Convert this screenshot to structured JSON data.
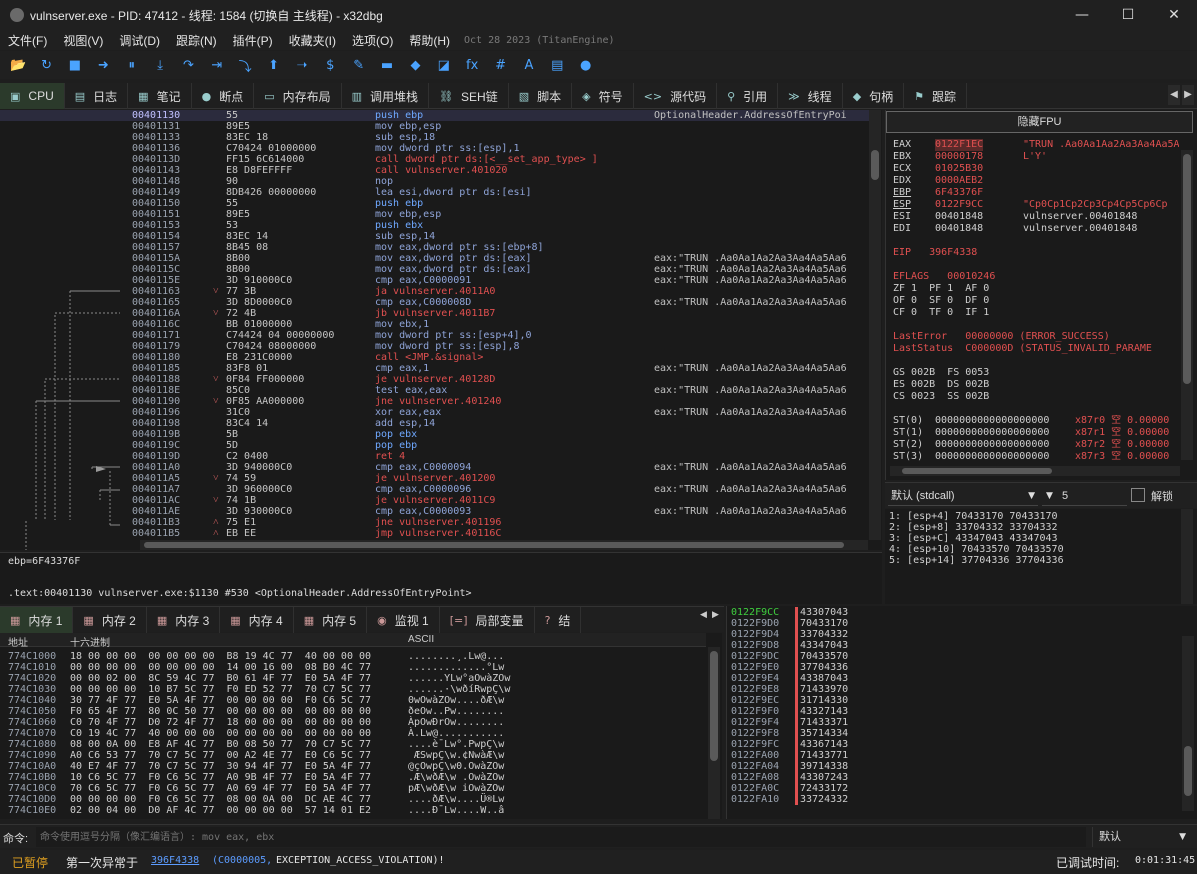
{
  "window": {
    "title": "vulnserver.exe - PID: 47412 - 线程: 1584 (切换自 主线程) - x32dbg",
    "minimize": "—",
    "maximize": "☐",
    "close": "✕"
  },
  "menu": {
    "items": [
      "文件(F)",
      "视图(V)",
      "调试(D)",
      "跟踪(N)",
      "插件(P)",
      "收藏夹(I)",
      "选项(O)",
      "帮助(H)"
    ],
    "version": "Oct 28 2023 (TitanEngine)"
  },
  "toolbar": {
    "icons": [
      "open-icon",
      "restart-icon",
      "stop-icon",
      "run-icon",
      "pause-icon",
      "step-into-icon",
      "step-over-icon",
      "trace-into-icon",
      "trace-over-icon",
      "execute-till-return-icon",
      "run-to-user-code-icon",
      "scylla-icon",
      "patch-icon",
      "comment-icon",
      "label-icon",
      "bookmark-icon",
      "function-icon",
      "hash-icon",
      "strings-icon",
      "calculator-icon",
      "globe-icon"
    ],
    "glyphs": [
      "📂",
      "↻",
      "■",
      "➜",
      "⏸",
      "⤓",
      "↷",
      "⇥",
      "⤵",
      "⬆",
      "➝",
      "$",
      "✎",
      "▬",
      "◆",
      "◪",
      "fx",
      "#",
      "A",
      "▤",
      "●"
    ]
  },
  "tabs": [
    {
      "label": "CPU",
      "icon": "▣"
    },
    {
      "label": "日志",
      "icon": "▤"
    },
    {
      "label": "笔记",
      "icon": "▦"
    },
    {
      "label": "断点",
      "icon": "●"
    },
    {
      "label": "内存布局",
      "icon": "▭"
    },
    {
      "label": "调用堆栈",
      "icon": "▥"
    },
    {
      "label": "SEH链",
      "icon": "⛓"
    },
    {
      "label": "脚本",
      "icon": "▧"
    },
    {
      "label": "符号",
      "icon": "◈"
    },
    {
      "label": "源代码",
      "icon": "<>"
    },
    {
      "label": "引用",
      "icon": "⚲"
    },
    {
      "label": "线程",
      "icon": "≫"
    },
    {
      "label": "句柄",
      "icon": "◆"
    },
    {
      "label": "跟踪",
      "icon": "⚑"
    }
  ],
  "disasm": {
    "rows": [
      {
        "addr": "00401130",
        "bytes": "55",
        "ins": "push ebp",
        "cmt": "OptionalHeader.AddressOfEntryPoi"
      },
      {
        "addr": "00401131",
        "bytes": "89E5",
        "ins": "mov ebp,esp",
        "cmt": ""
      },
      {
        "addr": "00401133",
        "bytes": "83EC 18",
        "ins": "sub esp,18",
        "cmt": ""
      },
      {
        "addr": "00401136",
        "bytes": "C70424 01000000",
        "ins": "mov dword ptr ss:[esp],1",
        "cmt": ""
      },
      {
        "addr": "0040113D",
        "bytes": "FF15 6C614000",
        "ins": "call dword ptr ds:[<__set_app_type> ]",
        "cmt": ""
      },
      {
        "addr": "00401143",
        "bytes": "E8 D8FEFFFF",
        "ins": "call vulnserver.401020",
        "cmt": ""
      },
      {
        "addr": "00401148",
        "bytes": "90",
        "ins": "nop",
        "cmt": ""
      },
      {
        "addr": "00401149",
        "bytes": "8DB426 00000000",
        "ins": "lea esi,dword ptr ds:[esi]",
        "cmt": ""
      },
      {
        "addr": "00401150",
        "bytes": "55",
        "ins": "push ebp",
        "cmt": ""
      },
      {
        "addr": "00401151",
        "bytes": "89E5",
        "ins": "mov ebp,esp",
        "cmt": ""
      },
      {
        "addr": "00401153",
        "bytes": "53",
        "ins": "push ebx",
        "cmt": ""
      },
      {
        "addr": "00401154",
        "bytes": "83EC 14",
        "ins": "sub esp,14",
        "cmt": ""
      },
      {
        "addr": "00401157",
        "bytes": "8B45 08",
        "ins": "mov eax,dword ptr ss:[ebp+8]",
        "cmt": ""
      },
      {
        "addr": "0040115A",
        "bytes": "8B00",
        "ins": "mov eax,dword ptr ds:[eax]",
        "cmt": "eax:\"TRUN .Aa0Aa1Aa2Aa3Aa4Aa5Aa6"
      },
      {
        "addr": "0040115C",
        "bytes": "8B00",
        "ins": "mov eax,dword ptr ds:[eax]",
        "cmt": "eax:\"TRUN .Aa0Aa1Aa2Aa3Aa4Aa5Aa6"
      },
      {
        "addr": "0040115E",
        "bytes": "3D 910000C0",
        "ins": "cmp eax,C0000091",
        "cmt": "eax:\"TRUN .Aa0Aa1Aa2Aa3Aa4Aa5Aa6"
      },
      {
        "addr": "00401163",
        "bytes": "77 3B",
        "ins": "ja vulnserver.4011A0",
        "cmt": "",
        "jm": "˅"
      },
      {
        "addr": "00401165",
        "bytes": "3D 8D0000C0",
        "ins": "cmp eax,C000008D",
        "cmt": "eax:\"TRUN .Aa0Aa1Aa2Aa3Aa4Aa5Aa6"
      },
      {
        "addr": "0040116A",
        "bytes": "72 4B",
        "ins": "jb vulnserver.4011B7",
        "cmt": "",
        "jm": "˅"
      },
      {
        "addr": "0040116C",
        "bytes": "BB 01000000",
        "ins": "mov ebx,1",
        "cmt": ""
      },
      {
        "addr": "00401171",
        "bytes": "C74424 04 00000000",
        "ins": "mov dword ptr ss:[esp+4],0",
        "cmt": ""
      },
      {
        "addr": "00401179",
        "bytes": "C70424 08000000",
        "ins": "mov dword ptr ss:[esp],8",
        "cmt": ""
      },
      {
        "addr": "00401180",
        "bytes": "E8 231C0000",
        "ins": "call <JMP.&signal>",
        "cmt": ""
      },
      {
        "addr": "00401185",
        "bytes": "83F8 01",
        "ins": "cmp eax,1",
        "cmt": "eax:\"TRUN .Aa0Aa1Aa2Aa3Aa4Aa5Aa6"
      },
      {
        "addr": "00401188",
        "bytes": "0F84 FF000000",
        "ins": "je vulnserver.40128D",
        "cmt": "",
        "jm": "˅"
      },
      {
        "addr": "0040118E",
        "bytes": "85C0",
        "ins": "test eax,eax",
        "cmt": "eax:\"TRUN .Aa0Aa1Aa2Aa3Aa4Aa5Aa6"
      },
      {
        "addr": "00401190",
        "bytes": "0F85 AA000000",
        "ins": "jne vulnserver.401240",
        "cmt": "",
        "jm": "˅"
      },
      {
        "addr": "00401196",
        "bytes": "31C0",
        "ins": "xor eax,eax",
        "cmt": "eax:\"TRUN .Aa0Aa1Aa2Aa3Aa4Aa5Aa6"
      },
      {
        "addr": "00401198",
        "bytes": "83C4 14",
        "ins": "add esp,14",
        "cmt": ""
      },
      {
        "addr": "0040119B",
        "bytes": "5B",
        "ins": "pop ebx",
        "cmt": ""
      },
      {
        "addr": "0040119C",
        "bytes": "5D",
        "ins": "pop ebp",
        "cmt": ""
      },
      {
        "addr": "0040119D",
        "bytes": "C2 0400",
        "ins": "ret 4",
        "cmt": ""
      },
      {
        "addr": "004011A0",
        "bytes": "3D 940000C0",
        "ins": "cmp eax,C0000094",
        "cmt": "eax:\"TRUN .Aa0Aa1Aa2Aa3Aa4Aa5Aa6"
      },
      {
        "addr": "004011A5",
        "bytes": "74 59",
        "ins": "je vulnserver.401200",
        "cmt": "",
        "jm": "˅"
      },
      {
        "addr": "004011A7",
        "bytes": "3D 960000C0",
        "ins": "cmp eax,C0000096",
        "cmt": "eax:\"TRUN .Aa0Aa1Aa2Aa3Aa4Aa5Aa6"
      },
      {
        "addr": "004011AC",
        "bytes": "74 1B",
        "ins": "je vulnserver.4011C9",
        "cmt": "",
        "jm": "˅"
      },
      {
        "addr": "004011AE",
        "bytes": "3D 930000C0",
        "ins": "cmp eax,C0000093",
        "cmt": "eax:\"TRUN .Aa0Aa1Aa2Aa3Aa4Aa5Aa6"
      },
      {
        "addr": "004011B3",
        "bytes": "75 E1",
        "ins": "jne vulnserver.401196",
        "cmt": "",
        "jm": "˄"
      },
      {
        "addr": "004011B5",
        "bytes": "EB EE",
        "ins": "jmp vulnserver.40116C",
        "cmt": "",
        "jm": "˄"
      }
    ],
    "ebp_line": "ebp=6F43376F",
    "location_line": ".text:00401130 vulnserver.exe:$1130 #530 <OptionalHeader.AddressOfEntryPoint>"
  },
  "registers": {
    "hide_fpu": "隐藏FPU",
    "gp": [
      {
        "name": "EAX",
        "val": "0122F1EC",
        "cmt": "\"TRUN .Aa0Aa1Aa2Aa3Aa4Aa5A"
      },
      {
        "name": "EBX",
        "val": "00000178",
        "cmt": "L'Ÿ'"
      },
      {
        "name": "ECX",
        "val": "01025B30",
        "cmt": ""
      },
      {
        "name": "EDX",
        "val": "0000AEB2",
        "cmt": ""
      },
      {
        "name": "EBP",
        "val": "6F43376F",
        "cmt": ""
      },
      {
        "name": "ESP",
        "val": "0122F9CC",
        "cmt": "\"Cp0Cp1Cp2Cp3Cp4Cp5Cp6Cp"
      },
      {
        "name": "ESI",
        "val": "00401848",
        "cmt": "vulnserver.00401848"
      },
      {
        "name": "EDI",
        "val": "00401848",
        "cmt": "vulnserver.00401848"
      }
    ],
    "eip": "EIP   396F4338",
    "eflags": "EFLAGS   00010246",
    "flags": [
      "ZF 1  PF 1  AF 0",
      "OF 0  SF 0  DF 0",
      "CF 0  TF 0  IF 1"
    ],
    "last_error": "LastError   00000000 (ERROR_SUCCESS)",
    "last_status": "LastStatus  C000000D (STATUS_INVALID_PARAME",
    "segs": [
      "GS 002B  FS 0053",
      "ES 002B  DS 002B",
      "CS 0023  SS 002B"
    ],
    "fpu": [
      {
        "n": "ST(0)",
        "v": "0000000000000000000",
        "t": "x87r0 空 0.00000"
      },
      {
        "n": "ST(1)",
        "v": "0000000000000000000",
        "t": "x87r1 空 0.00000"
      },
      {
        "n": "ST(2)",
        "v": "0000000000000000000",
        "t": "x87r2 空 0.00000"
      },
      {
        "n": "ST(3)",
        "v": "0000000000000000000",
        "t": "x87r3 空 0.00000"
      }
    ]
  },
  "callconv": {
    "selected": "默认 (stdcall)",
    "count": "5",
    "unlock": "解锁"
  },
  "stackargs": [
    "1: [esp+4] 70433170 70433170",
    "2: [esp+8] 33704332 33704332",
    "3: [esp+C] 43347043 43347043",
    "4: [esp+10] 70433570 70433570",
    "5: [esp+14] 37704336 37704336"
  ],
  "dump_tabs": [
    {
      "label": "内存 1",
      "icon": "▦"
    },
    {
      "label": "内存 2",
      "icon": "▦"
    },
    {
      "label": "内存 3",
      "icon": "▦"
    },
    {
      "label": "内存 4",
      "icon": "▦"
    },
    {
      "label": "内存 5",
      "icon": "▦"
    },
    {
      "label": "监视 1",
      "icon": "◉"
    },
    {
      "label": "局部变量",
      "icon": "[=]"
    },
    {
      "label": "结",
      "icon": "?"
    }
  ],
  "dump": {
    "headers": {
      "addr": "地址",
      "hex": "十六进制",
      "ascii": "ASCII"
    },
    "rows": [
      {
        "a": "774C1000",
        "h": "18 00 00 00  00 00 00 00  B8 19 4C 77  40 00 00 00",
        "s": "........¸.Lw@..."
      },
      {
        "a": "774C1010",
        "h": "00 00 00 00  00 00 00 00  14 00 16 00  08 B0 4C 77",
        "s": ".............°Lw"
      },
      {
        "a": "774C1020",
        "h": "00 00 02 00  8C 59 4C 77  B0 61 4F 77  E0 5A 4F 77",
        "s": "......YLw°aOwàZOw"
      },
      {
        "a": "774C1030",
        "h": "00 00 00 00  10 B7 5C 77  F0 ED 52 77  70 C7 5C 77",
        "s": "......·\\wðíRwpÇ\\w"
      },
      {
        "a": "774C1040",
        "h": "30 77 4F 77  E0 5A 4F 77  00 00 00 00  F0 C6 5C 77",
        "s": "0wOwàZOw....ðÆ\\w"
      },
      {
        "a": "774C1050",
        "h": "F0 65 4F 77  80 0C 50 77  00 00 00 00  00 00 00 00",
        "s": "ðeOw..Pw........"
      },
      {
        "a": "774C1060",
        "h": "C0 70 4F 77  D0 72 4F 77  18 00 00 00  00 00 00 00",
        "s": "ÀpOwÐrOw........"
      },
      {
        "a": "774C1070",
        "h": "C0 19 4C 77  40 00 00 00  00 00 00 00  00 00 00 00",
        "s": "À.Lw@..........."
      },
      {
        "a": "774C1080",
        "h": "08 00 0A 00  E8 AF 4C 77  B0 08 50 77  70 C7 5C 77",
        "s": "....è¯Lw°.PwpÇ\\w"
      },
      {
        "a": "774C1090",
        "h": "A0 C6 53 77  70 C7 5C 77  00 A2 4E 77  E0 C6 5C 77",
        "s": " ÆSwpÇ\\w.¢NwàÆ\\w"
      },
      {
        "a": "774C10A0",
        "h": "40 E7 4F 77  70 C7 5C 77  30 94 4F 77  E0 5A 4F 77",
        "s": "@çOwpÇ\\w0.OwàZOw"
      },
      {
        "a": "774C10B0",
        "h": "10 C6 5C 77  F0 C6 5C 77  A0 9B 4F 77  E0 5A 4F 77",
        "s": ".Æ\\wðÆ\\w .OwàZOw"
      },
      {
        "a": "774C10C0",
        "h": "70 C6 5C 77  F0 C6 5C 77  A0 69 4F 77  E0 5A 4F 77",
        "s": "pÆ\\wðÆ\\w iOwàZOw"
      },
      {
        "a": "774C10D0",
        "h": "00 00 00 00  F0 C6 5C 77  08 00 0A 00  DC AE 4C 77",
        "s": "....ðÆ\\w....Ü®Lw"
      },
      {
        "a": "774C10E0",
        "h": "02 00 04 00  D0 AF 4C 77  00 00 00 00  57 14 01 E2",
        "s": "....Ð¯Lw....W..â"
      }
    ]
  },
  "stack": [
    {
      "a": "0122F9CC",
      "v": "43307043"
    },
    {
      "a": "0122F9D0",
      "v": "70433170"
    },
    {
      "a": "0122F9D4",
      "v": "33704332"
    },
    {
      "a": "0122F9D8",
      "v": "43347043"
    },
    {
      "a": "0122F9DC",
      "v": "70433570"
    },
    {
      "a": "0122F9E0",
      "v": "37704336"
    },
    {
      "a": "0122F9E4",
      "v": "43387043"
    },
    {
      "a": "0122F9E8",
      "v": "71433970"
    },
    {
      "a": "0122F9EC",
      "v": "31714330"
    },
    {
      "a": "0122F9F0",
      "v": "43327143"
    },
    {
      "a": "0122F9F4",
      "v": "71433371"
    },
    {
      "a": "0122F9F8",
      "v": "35714334"
    },
    {
      "a": "0122F9FC",
      "v": "43367143"
    },
    {
      "a": "0122FA00",
      "v": "71433771"
    },
    {
      "a": "0122FA04",
      "v": "39714338"
    },
    {
      "a": "0122FA08",
      "v": "43307243"
    },
    {
      "a": "0122FA0C",
      "v": "72433172"
    },
    {
      "a": "0122FA10",
      "v": "33724332"
    }
  ],
  "command": {
    "label": "命令:",
    "placeholder": "命令使用逗号分隔（像汇编语言）: mov eax, ebx",
    "mode": "默认"
  },
  "status": {
    "state": "已暂停",
    "msg_prefix": "第一次异常于",
    "addr": "396F4338",
    "code": "(C0000005,",
    "name": " EXCEPTION_ACCESS_VIOLATION)!",
    "time_label": "已调试时间:",
    "time": "0:01:31:45"
  },
  "colors": {
    "accent": "#3fcf3f",
    "paused": "#e0a020",
    "jump": "#d06060",
    "link": "#5c9cff",
    "reg_changed": "#e05050"
  }
}
